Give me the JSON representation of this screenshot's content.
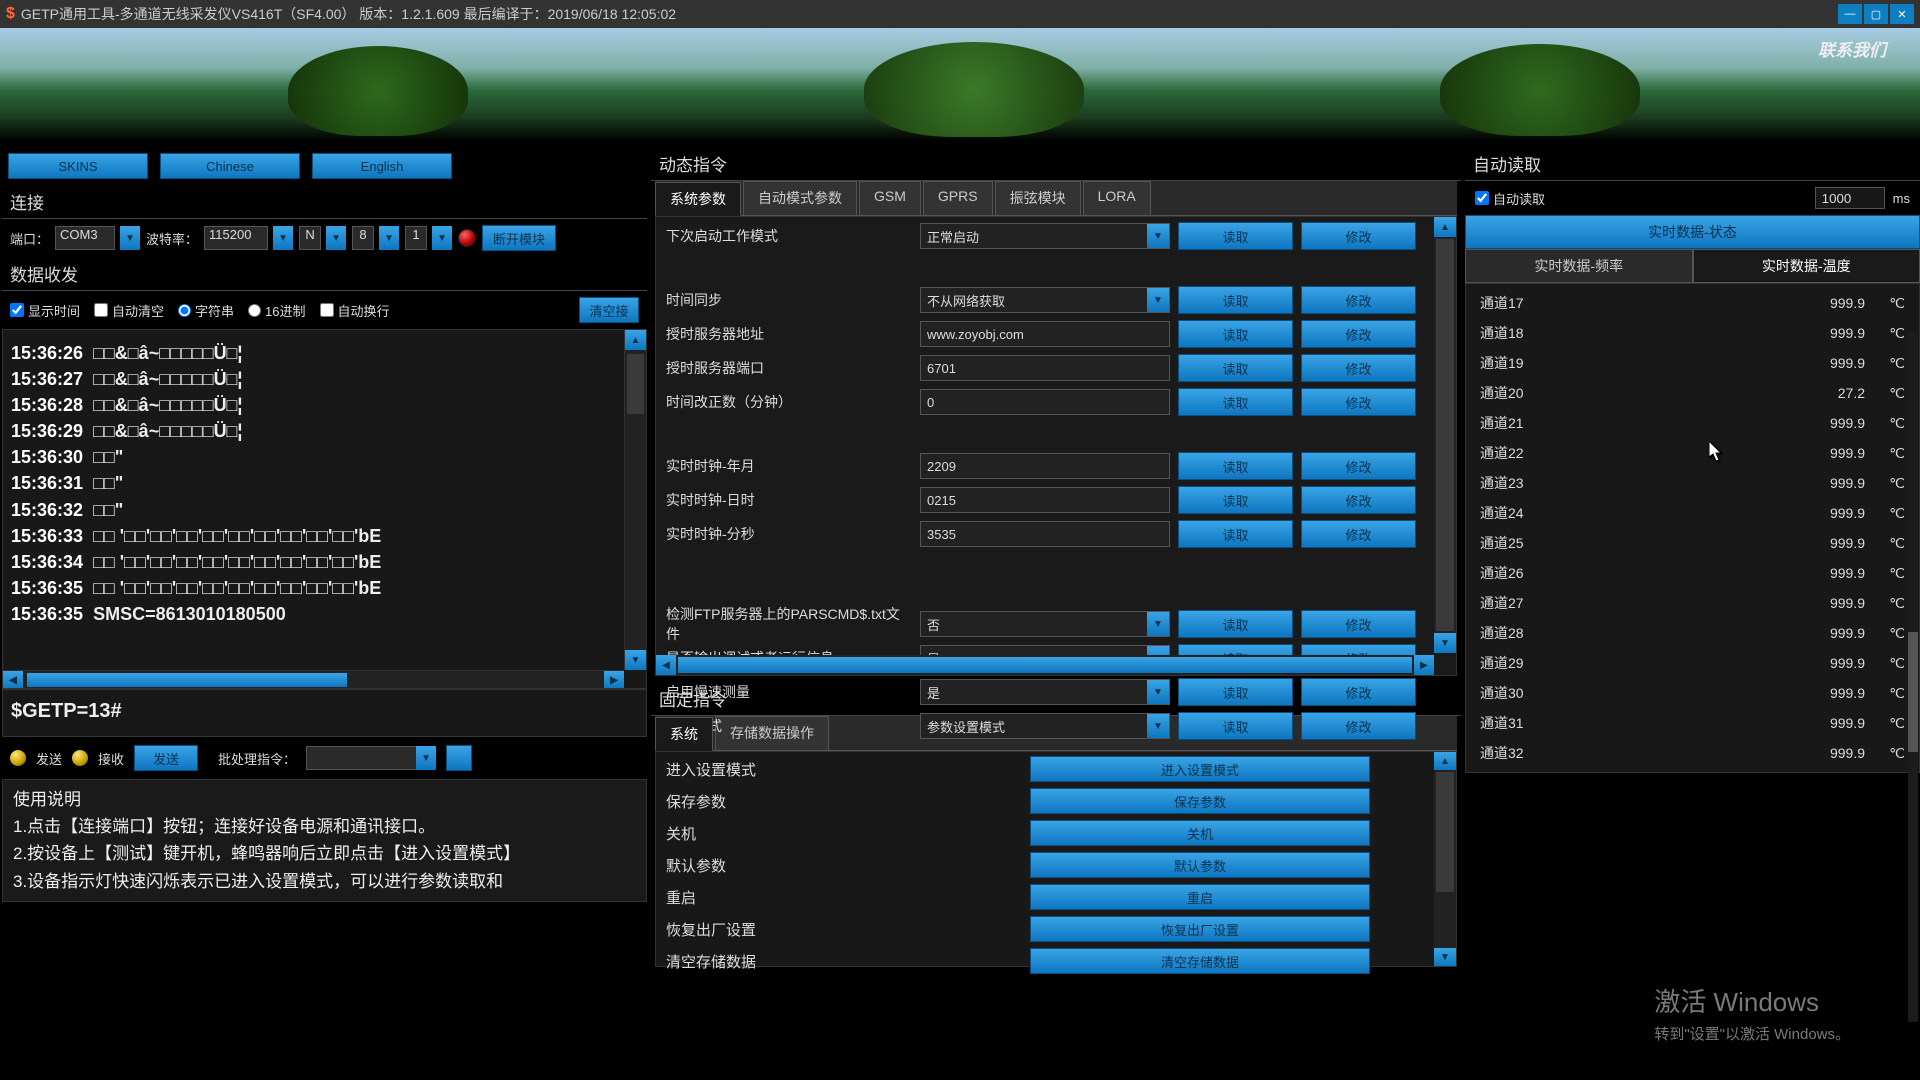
{
  "title": "GETP通用工具-多通道无线采发仪VS416T（SF4.00）   版本：1.2.1.609 最后编译于：2019/06/18 12:05:02",
  "banner_contact": "联系我们",
  "left": {
    "btn_skins": "SKINS",
    "btn_chinese": "Chinese",
    "btn_english": "English",
    "section_connect": "连接",
    "lbl_port": "端口：",
    "val_port": "COM3",
    "lbl_baud": "波特率：",
    "val_baud": "115200",
    "val_parity": "N",
    "val_data": "8",
    "val_stop": "1",
    "btn_open": "断开模块",
    "section_rxtx": "数据收发",
    "chk_showtime": "显示时间",
    "chk_autoclr": "自动清空",
    "rad_char": "字符串",
    "rad_hex": "16进制",
    "chk_wrap": "自动换行",
    "btn_clear_recv": "清空接",
    "log": [
      {
        "t": "15:36:26",
        "m": " □□&□â~□□□□□Ü□¦"
      },
      {
        "t": "15:36:27",
        "m": " □□&□â~□□□□□Ü□¦"
      },
      {
        "t": "15:36:28",
        "m": " □□&□â~□□□□□Ü□¦"
      },
      {
        "t": "15:36:29",
        "m": " □□&□â~□□□□□Ü□¦"
      },
      {
        "t": "15:36:30",
        "m": " □□\""
      },
      {
        "t": "15:36:31",
        "m": " □□\""
      },
      {
        "t": "15:36:32",
        "m": " □□\""
      },
      {
        "t": "15:36:33",
        "m": " □□ '□□'□□'□□'□□'□□'□□'□□'□□'□□'bE"
      },
      {
        "t": "15:36:34",
        "m": " □□ '□□'□□'□□'□□'□□'□□'□□'□□'□□'bE"
      },
      {
        "t": "15:36:35",
        "m": " □□ '□□'□□'□□'□□'□□'□□'□□'□□'□□'bE"
      },
      {
        "t": "15:36:35",
        "m": " SMSC=8613010180500"
      }
    ],
    "cmd": "$GETP=13#",
    "lbl_send": "发送",
    "lbl_recv": "接收",
    "btn_send": "发送",
    "lbl_batch": "批处理指令：",
    "help_title": "使用说明",
    "help1": "1.点击【连接端口】按钮；连接好设备电源和通讯接口。",
    "help2": "2.按设备上【测试】键开机，蜂鸣器响后立即点击【进入设置模式】",
    "help3": "3.设备指示灯快速闪烁表示已进入设置模式，可以进行参数读取和"
  },
  "mid": {
    "section_dyn": "动态指令",
    "tabs": [
      "系统参数",
      "自动模式参数",
      "GSM",
      "GPRS",
      "振弦模块",
      "LORA"
    ],
    "active_tab": 0,
    "btn_read": "读取",
    "btn_write": "修改",
    "params": [
      {
        "lbl": "下次启动工作模式",
        "val": "正常启动",
        "combo": true
      },
      {
        "gap": true
      },
      {
        "lbl": "时间同步",
        "val": "不从网络获取",
        "combo": true
      },
      {
        "lbl": "授时服务器地址",
        "val": "www.zoyobj.com",
        "combo": false
      },
      {
        "lbl": "授时服务器端口",
        "val": "6701",
        "combo": false
      },
      {
        "lbl": "时间改正数（分钟）",
        "val": "0",
        "combo": false
      },
      {
        "gap": true
      },
      {
        "lbl": "实时时钟-年月",
        "val": "2209",
        "combo": false
      },
      {
        "lbl": "实时时钟-日时",
        "val": "0215",
        "combo": false
      },
      {
        "lbl": "实时时钟-分秒",
        "val": "3535",
        "combo": false
      },
      {
        "gap": true
      },
      {
        "gap": true
      },
      {
        "lbl": "检测FTP服务器上的PARSCMD$.txt文件",
        "val": "否",
        "combo": true
      },
      {
        "lbl": "是否输出调试或者运行信息",
        "val": "是",
        "combo": true
      },
      {
        "lbl": "启用慢速测量",
        "val": "是",
        "combo": true
      },
      {
        "lbl": "工作模式",
        "val": "参数设置模式",
        "combo": true
      }
    ],
    "section_fixed": "固定指令",
    "ftabs": [
      "系统",
      "存储数据操作"
    ],
    "factive": 0,
    "fixed": [
      {
        "lbl": "进入设置模式",
        "btn": "进入设置模式"
      },
      {
        "lbl": "保存参数",
        "btn": "保存参数"
      },
      {
        "lbl": "关机",
        "btn": "关机"
      },
      {
        "lbl": "默认参数",
        "btn": "默认参数"
      },
      {
        "lbl": "重启",
        "btn": "重启"
      },
      {
        "lbl": "恢复出厂设置",
        "btn": "恢复出厂设置"
      },
      {
        "lbl": "清空存储数据",
        "btn": "清空存储数据"
      }
    ]
  },
  "right": {
    "section": "自动读取",
    "chk": "自动读取",
    "interval": "1000",
    "unit": "ms",
    "tab_status": "实时数据-状态",
    "tab_freq": "实时数据-频率",
    "tab_temp": "实时数据-温度",
    "channels": [
      {
        "n": "通道17",
        "v": "999.9",
        "u": "℃"
      },
      {
        "n": "通道18",
        "v": "999.9",
        "u": "℃"
      },
      {
        "n": "通道19",
        "v": "999.9",
        "u": "℃"
      },
      {
        "n": "通道20",
        "v": "27.2",
        "u": "℃"
      },
      {
        "n": "通道21",
        "v": "999.9",
        "u": "℃"
      },
      {
        "n": "通道22",
        "v": "999.9",
        "u": "℃"
      },
      {
        "n": "通道23",
        "v": "999.9",
        "u": "℃"
      },
      {
        "n": "通道24",
        "v": "999.9",
        "u": "℃"
      },
      {
        "n": "通道25",
        "v": "999.9",
        "u": "℃"
      },
      {
        "n": "通道26",
        "v": "999.9",
        "u": "℃"
      },
      {
        "n": "通道27",
        "v": "999.9",
        "u": "℃"
      },
      {
        "n": "通道28",
        "v": "999.9",
        "u": "℃"
      },
      {
        "n": "通道29",
        "v": "999.9",
        "u": "℃"
      },
      {
        "n": "通道30",
        "v": "999.9",
        "u": "℃"
      },
      {
        "n": "通道31",
        "v": "999.9",
        "u": "℃"
      },
      {
        "n": "通道32",
        "v": "999.9",
        "u": "℃"
      }
    ]
  },
  "watermark": {
    "big": "激活 Windows",
    "small": "转到\"设置\"以激活 Windows。"
  }
}
